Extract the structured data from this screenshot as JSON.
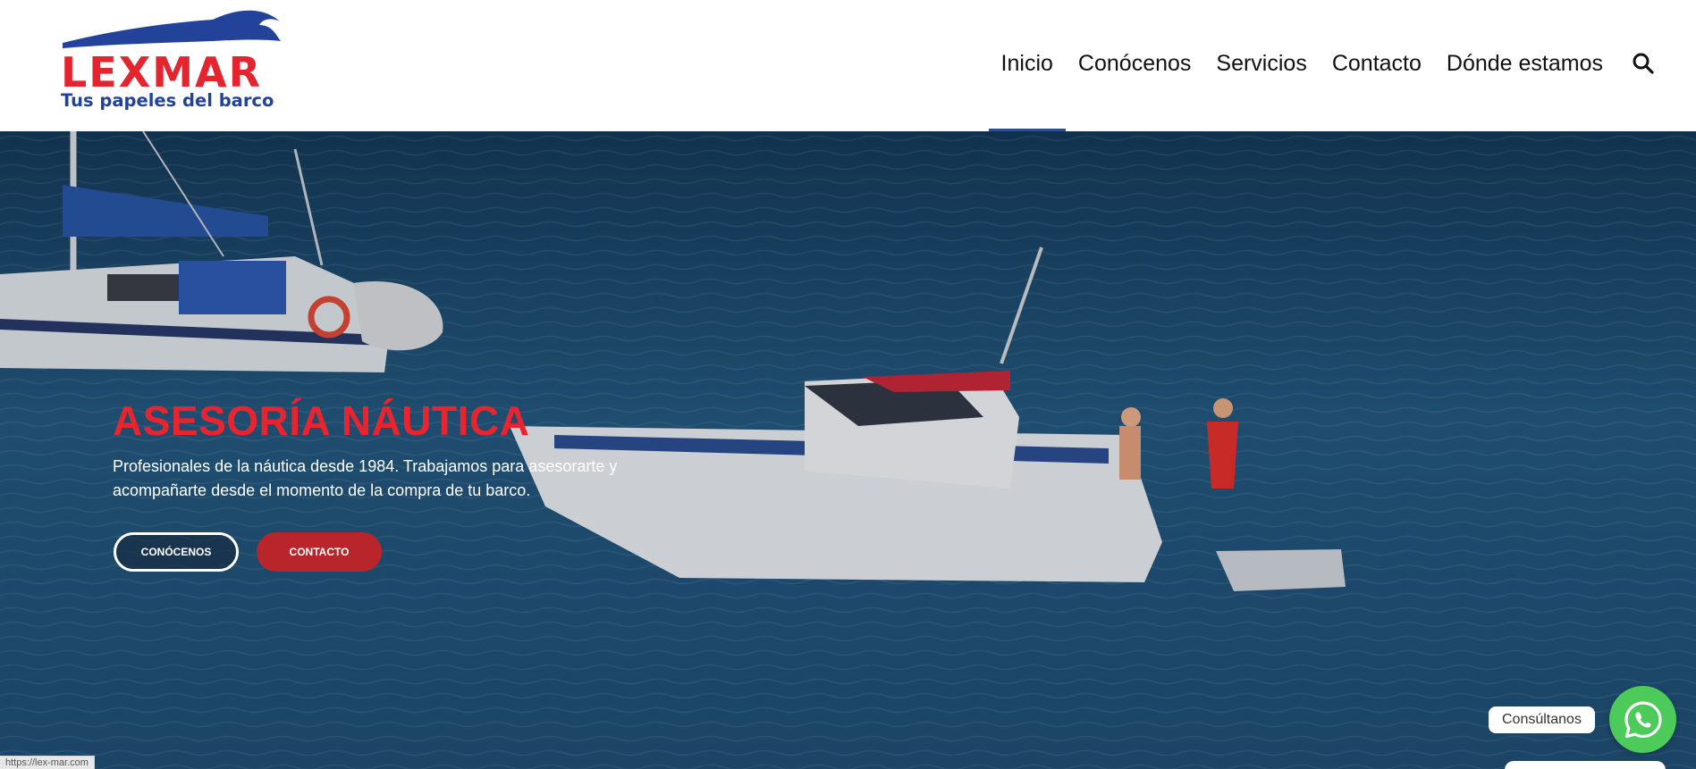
{
  "brand": {
    "name": "LEXMAR",
    "tagline": "Tus papeles del barco",
    "colors": {
      "red": "#e4242e",
      "blue": "#23429a"
    }
  },
  "nav": {
    "items": [
      {
        "label": "Inicio",
        "active": true
      },
      {
        "label": "Conócenos",
        "active": false
      },
      {
        "label": "Servicios",
        "active": false
      },
      {
        "label": "Contacto",
        "active": false
      },
      {
        "label": "Dónde estamos",
        "active": false
      }
    ],
    "search_icon": "search-icon",
    "active_color": "#2d4e93"
  },
  "hero": {
    "title": "ASESORÍA NÁUTICA",
    "text": "Profesionales de la náutica desde 1984. Trabajamos para asesorarte y acompañarte desde el momento de la compra de tu barco.",
    "buttons": {
      "primary": "CONÓCENOS",
      "secondary": "CONTACTO"
    },
    "title_color": "#e8252f",
    "background": "photo of boats on blue sea"
  },
  "whatsapp": {
    "label": "Consúltanos",
    "icon": "whatsapp-icon",
    "color": "#4ccb5b"
  },
  "status_bar": {
    "url": "https://lex-mar.com"
  }
}
